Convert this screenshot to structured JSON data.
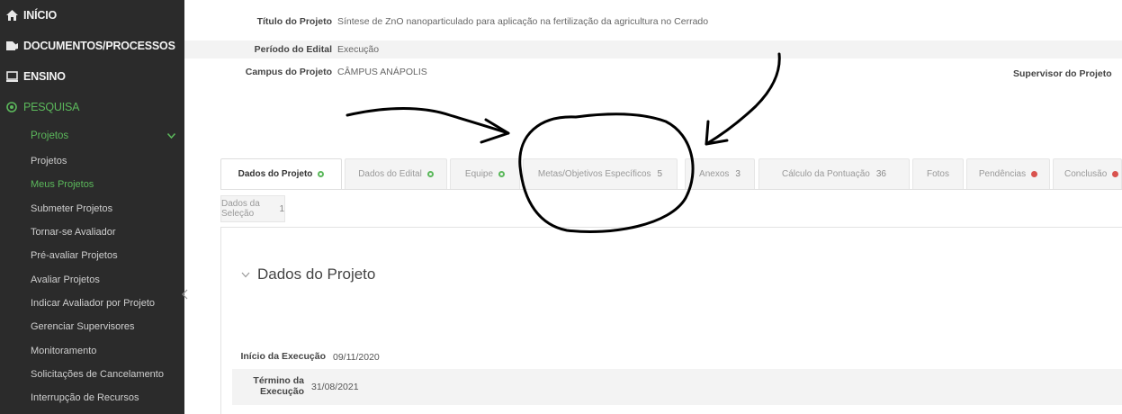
{
  "sidebar": {
    "main_items": [
      {
        "label": "INÍCIO",
        "icon": "home-icon"
      },
      {
        "label": "DOCUMENTOS/PROCESSOS",
        "icon": "document-icon"
      },
      {
        "label": "ENSINO",
        "icon": "ensino-icon"
      },
      {
        "label": "PESQUISA",
        "icon": "pesquisa-icon"
      }
    ],
    "submenu_header": "Projetos",
    "submenu_items": [
      "Projetos",
      "Meus Projetos",
      "Submeter Projetos",
      "Tornar-se Avaliador",
      "Pré-avaliar Projetos",
      "Avaliar Projetos",
      "Indicar Avaliador por Projeto",
      "Gerenciar Supervisores",
      "Monitoramento",
      "Solicitações de Cancelamento",
      "Interrupção de Recursos"
    ],
    "colors": {
      "bg": "#2b2b2b",
      "accent": "#5bb85b"
    }
  },
  "header": {
    "titulo_label": "Título do Projeto",
    "titulo_value": "Síntese de ZnO nanoparticulado para aplicação na fertilização da agricultura no Cerrado",
    "periodo_label": "Período do Edital",
    "periodo_value": "Execução",
    "campus_label": "Campus do Projeto",
    "campus_value": "CÂMPUS ANÁPOLIS",
    "supervisor_label": "Supervisor do Projeto"
  },
  "tabs": [
    {
      "label": "Dados do Projeto",
      "status": "ok"
    },
    {
      "label": "Dados do Edital",
      "status": "ok"
    },
    {
      "label": "Equipe",
      "status": "ok"
    },
    {
      "label": "Metas/Objetivos Específicos",
      "count": "5"
    },
    {
      "label": "Anexos",
      "count": "3"
    },
    {
      "label": "Cálculo da Pontuação",
      "count": "36"
    },
    {
      "label": "Fotos"
    },
    {
      "label": "Pendências",
      "status": "err"
    },
    {
      "label": "Conclusão",
      "status": "err"
    }
  ],
  "tab_row2": {
    "label": "Dados da Seleção",
    "count": "1"
  },
  "section": {
    "title": "Dados do Projeto",
    "fields": [
      {
        "label": "Início da Execução",
        "value": "09/11/2020"
      },
      {
        "label": "Término da Execução",
        "value": "31/08/2021"
      }
    ]
  }
}
